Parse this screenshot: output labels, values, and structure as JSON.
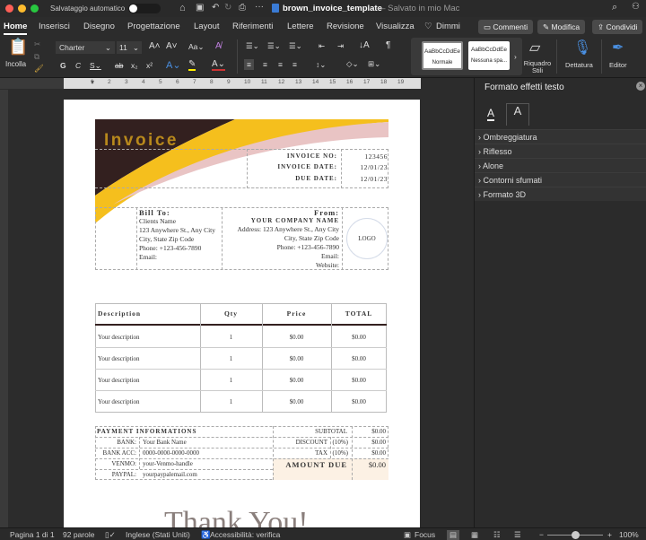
{
  "titlebar": {
    "autosave": "Salvataggio automatico",
    "doc_name": "brown_invoice_template",
    "saved": "— Salvato in mio Mac"
  },
  "tabs": [
    "Home",
    "Inserisci",
    "Disegno",
    "Progettazione",
    "Layout",
    "Riferimenti",
    "Lettere",
    "Revisione",
    "Visualizza",
    "Dimmi"
  ],
  "actions": {
    "comments": "Commenti",
    "edit": "Modifica",
    "share": "Condividi"
  },
  "ribbon": {
    "paste": "Incolla",
    "font": "Charter",
    "size": "11",
    "styles": [
      {
        "preview": "AaBbCcDdEe",
        "name": "Normale"
      },
      {
        "preview": "AaBbCcDdEe",
        "name": "Nessuna spa..."
      }
    ],
    "styles_pane": "Riquadro Stili",
    "dictation": "Dettatura",
    "editor": "Editor",
    "ruler_numbers": [
      "1",
      "2",
      "3",
      "4",
      "5",
      "6",
      "7",
      "8",
      "9",
      "10",
      "11",
      "12",
      "13",
      "14",
      "15",
      "16",
      "17",
      "18",
      "19"
    ]
  },
  "invoice": {
    "title": "Invoice",
    "meta": [
      {
        "label": "INVOICE NO:",
        "value": "123456"
      },
      {
        "label": "INVOICE DATE:",
        "value": "12/01/23"
      },
      {
        "label": "DUE DATE:",
        "value": "12/01/23"
      }
    ],
    "bill_to": {
      "heading": "Bill To:",
      "lines": [
        "Clients Name",
        "123 Anywhere St., Any City",
        "City, State Zip Code",
        "Phone:  +123-456-7890",
        "Email:"
      ]
    },
    "from": {
      "heading": "From:",
      "company": "YOUR COMPANY NAME",
      "lines": [
        "Address:  123 Anywhere St., Any City",
        "City, State Zip Code",
        "Phone:  +123-456-7890",
        "Email:",
        "Website:"
      ]
    },
    "logo": "LOGO",
    "items_header": [
      "Description",
      "Qty",
      "Price",
      "TOTAL"
    ],
    "items": [
      [
        "Your description",
        "1",
        "$0.00",
        "$0.00"
      ],
      [
        "Your description",
        "1",
        "$0.00",
        "$0.00"
      ],
      [
        "Your description",
        "1",
        "$0.00",
        "$0.00"
      ],
      [
        "Your description",
        "1",
        "$0.00",
        "$0.00"
      ]
    ],
    "payment": {
      "heading": "PAYMENT INFORMATIONS",
      "rows": [
        {
          "label": "BANK:",
          "value": "Your Bank Name"
        },
        {
          "label": "BANK ACC:",
          "value": "0000-0000-0000-0000"
        },
        {
          "label": "VENMO:",
          "value": "your-Venmo-handle"
        },
        {
          "label": "PAYPAL:",
          "value": "yourpaypalemail.com"
        }
      ]
    },
    "totals": {
      "subtotal_label": "SUBTOTAL",
      "subtotal": "$0.00",
      "discount_label": "DISCOUNT",
      "discount_pct": "(10%)",
      "discount": "$0.00",
      "tax_label": "TAX",
      "tax_pct": "(10%)",
      "tax": "$0.00",
      "due_label": "AMOUNT DUE",
      "due": "$0.00"
    },
    "thanks": "Thank You!",
    "colors": {
      "brown": "#33201f",
      "yellow": "#f5bf1d",
      "pink": "#e9c4c4",
      "title": "#b8891c",
      "due_bg": "#fcf1e4"
    }
  },
  "panel": {
    "title": "Formato effetti testo",
    "sections": [
      "Ombreggiatura",
      "Riflesso",
      "Alone",
      "Contorni sfumati",
      "Formato 3D"
    ]
  },
  "status": {
    "page": "Pagina 1 di 1",
    "words": "92 parole",
    "language": "Inglese (Stati Uniti)",
    "accessibility": "Accessibilità: verifica",
    "focus": "Focus",
    "zoom": "100%",
    "zoom_level": 1.0
  }
}
